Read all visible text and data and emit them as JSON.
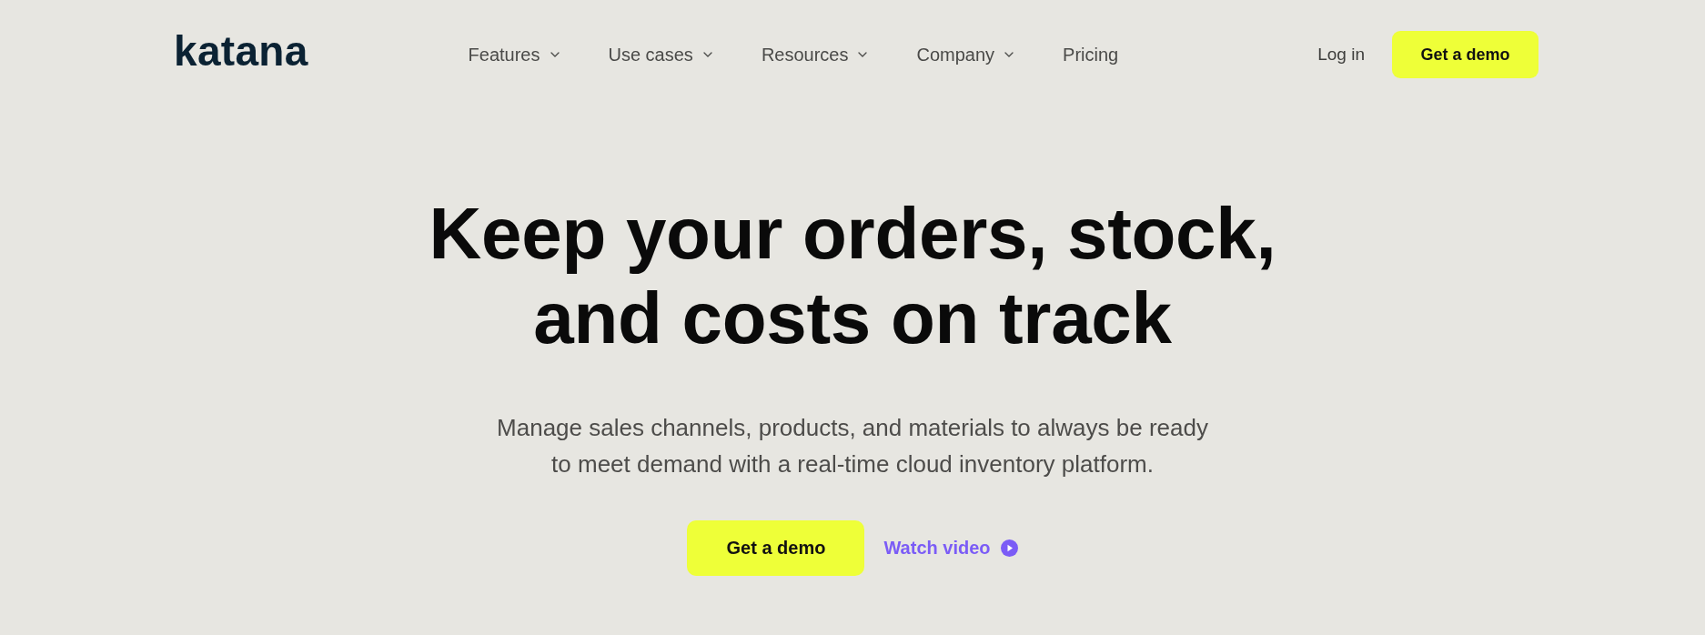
{
  "header": {
    "logo": "katana",
    "nav": [
      {
        "label": "Features",
        "kind": "dropdown"
      },
      {
        "label": "Use cases",
        "kind": "dropdown"
      },
      {
        "label": "Resources",
        "kind": "dropdown"
      },
      {
        "label": "Company",
        "kind": "dropdown"
      },
      {
        "label": "Pricing",
        "kind": "link"
      }
    ],
    "login": "Log in",
    "cta": "Get a demo"
  },
  "hero": {
    "title": "Keep your orders, stock, and costs on track",
    "subtitle": "Manage sales channels, products, and materials to always be ready to meet demand with a real-time cloud inventory platform.",
    "primary_button": "Get a demo",
    "video_link": "Watch video"
  }
}
